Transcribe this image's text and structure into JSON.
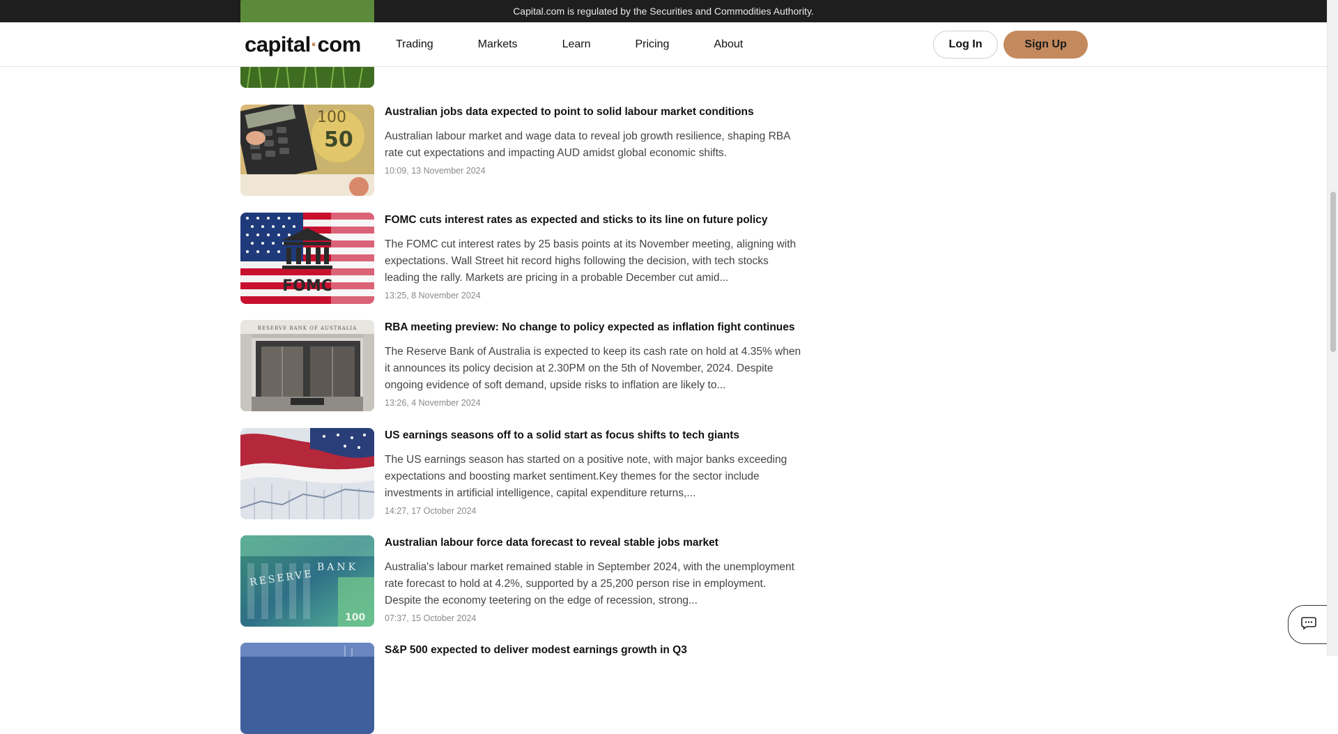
{
  "regulatory_notice": "Capital.com is regulated by the Securities and Commodities Authority.",
  "header": {
    "logo_left": "capital",
    "logo_dot": "·",
    "logo_right": "com",
    "nav": [
      "Trading",
      "Markets",
      "Learn",
      "Pricing",
      "About"
    ],
    "login_label": "Log In",
    "signup_label": "Sign Up"
  },
  "articles": [
    {
      "title": "Australian jobs data expected to point to solid labour market conditions",
      "description": "Australian labour market and wage data to reveal job growth resilience, shaping RBA rate cut expectations and impacting AUD amidst global economic shifts.",
      "date": "10:09, 13 November 2024",
      "image": "calculator-australian-banknotes"
    },
    {
      "title": "FOMC cuts interest rates as expected and sticks to its line on future policy",
      "description": "The FOMC cut interest rates by 25 basis points at its November meeting, aligning with expectations. Wall Street hit record highs following the decision, with tech stocks leading the rally. Markets are pricing in a probable December cut amid...",
      "date": "13:25, 8 November 2024",
      "image": "us-flag-fomc",
      "image_text": "FOMC"
    },
    {
      "title": "RBA meeting preview: No change to policy expected as inflation fight continues",
      "description": "The Reserve Bank of Australia is expected to keep its cash rate on hold at 4.35% when it announces its policy decision at 2.30PM on the 5th of November, 2024. Despite ongoing evidence of soft demand, upside risks to inflation are likely to...",
      "date": "13:26, 4 November 2024",
      "image": "reserve-bank-entrance",
      "image_text": "RESERVE BANK OF AUSTRALIA"
    },
    {
      "title": "US earnings seasons off to a solid start as focus shifts to tech giants",
      "description": "The US earnings season has started on a positive note, with major banks exceeding expectations and boosting market sentiment.Key themes for the sector include investments in artificial intelligence, capital expenditure returns,...",
      "date": "14:27, 17 October 2024",
      "image": "us-flag-financial-chart"
    },
    {
      "title": "Australian labour force data forecast to reveal stable jobs market",
      "description": "Australia's labour market remained stable in September 2024, with the unemployment rate forecast to hold at 4.2%, supported by a 25,200 person rise in employment. Despite the economy teetering on the edge of recession, strong...",
      "date": "07:37, 15 October 2024",
      "image": "reserve-bank-banknote",
      "image_text_1": "RESERVE",
      "image_text_2": "BANK",
      "image_text_3": "100"
    },
    {
      "title": "S&P 500 expected to deliver modest earnings growth in Q3",
      "description": "",
      "date": "",
      "image": "market-chart"
    }
  ],
  "colors": {
    "accent": "#c48a5e",
    "top_bar": "#1e1e1e"
  },
  "icons": {
    "chat": "chat-bubble-icon"
  }
}
